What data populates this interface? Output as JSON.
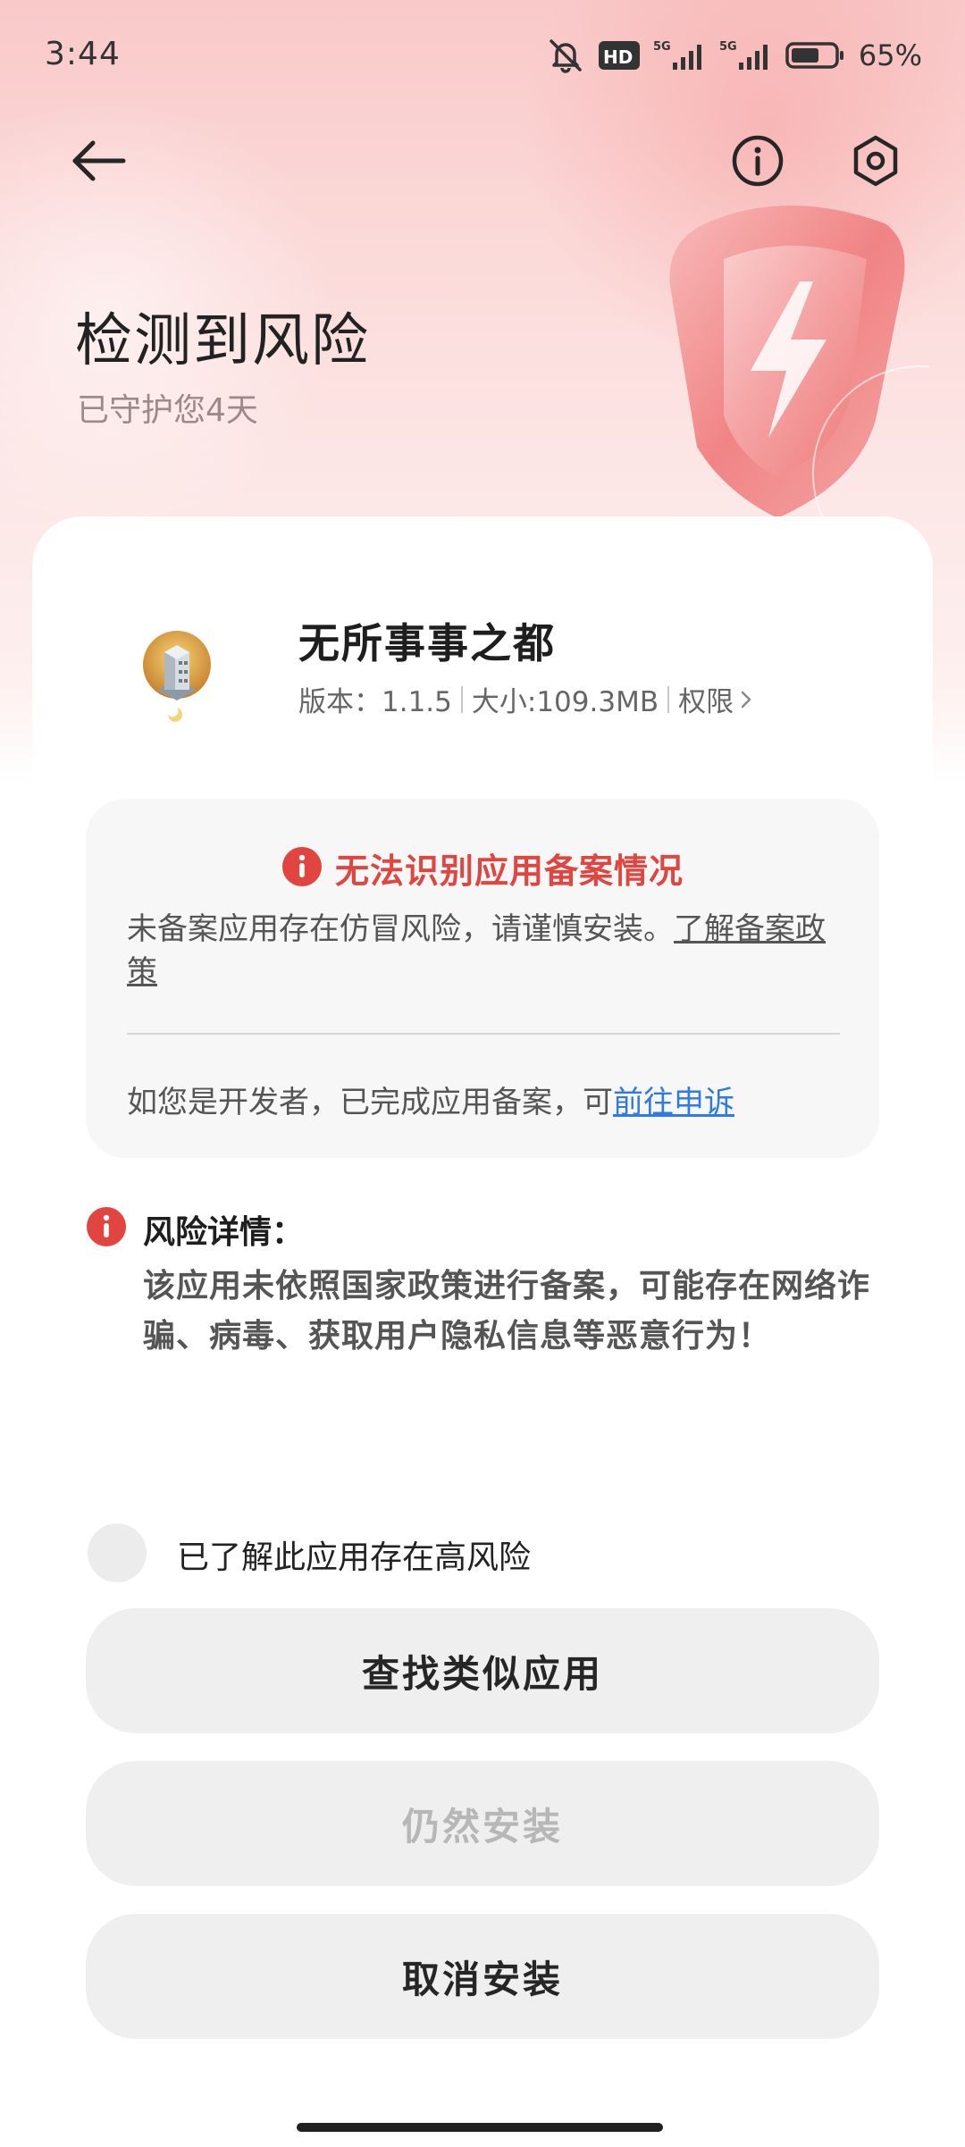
{
  "status_bar": {
    "time": "3:44",
    "network_1": "5G",
    "network_2": "5G",
    "hd_badge": "HD",
    "battery_level": 65,
    "battery_text": "65%",
    "icons": [
      "mute-icon",
      "hd-icon",
      "signal-icon",
      "signal-icon",
      "battery-icon"
    ]
  },
  "header": {
    "back_icon": "arrow-left-icon",
    "info_icon": "info-icon",
    "settings_icon": "hexagon-settings-icon",
    "title": "检测到风险",
    "subtitle": "已守护您4天"
  },
  "app": {
    "name": "无所事事之都",
    "version_label": "版本：1.1.5",
    "size_label": "大小:109.3MB",
    "permissions_label": "权限"
  },
  "warning": {
    "title": "无法识别应用备案情况",
    "description": "未备案应用存在仿冒风险，请谨慎安装。",
    "policy_link": "了解备案政策",
    "developer_prefix": "如您是开发者，已完成应用备案，可",
    "appeal_link": "前往申诉"
  },
  "risk": {
    "heading": "风险详情：",
    "body": "该应用未依照国家政策进行备案，可能存在网络诈骗、病毒、获取用户隐私信息等恶意行为！"
  },
  "acknowledge": {
    "label": "已了解此应用存在高风险",
    "checked": false
  },
  "actions": {
    "find_similar": "查找类似应用",
    "install_anyway": "仍然安装",
    "cancel_install": "取消安装"
  },
  "colors": {
    "accent_red": "#e0463f",
    "link_blue": "#2f7ae5",
    "button_bg": "#efefef"
  }
}
